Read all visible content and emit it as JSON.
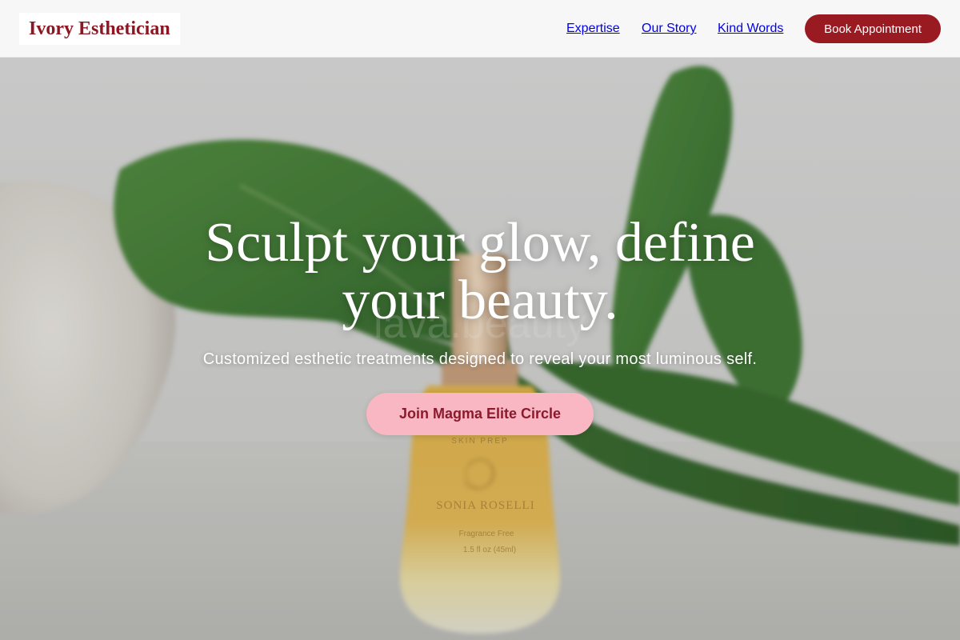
{
  "brand": {
    "name": "Ivory Esthetician"
  },
  "nav": {
    "items": [
      {
        "label": "Expertise"
      },
      {
        "label": "Our Story"
      },
      {
        "label": "Kind Words"
      }
    ],
    "cta_label": "Book Appointment"
  },
  "hero": {
    "title": "Sculpt your glow, define your beauty.",
    "subtitle": "Customized esthetic treatments designed to reveal your most luminous self.",
    "cta_label": "Join Magma Elite Circle",
    "background_text": {
      "watermark": "lava.beauty",
      "label_top": "SKIN PREP",
      "brand_on_bottle": "SONIA ROSELLI",
      "label_line_1": "Fragrance Free",
      "label_line_2": "1.5 fl oz (45ml)"
    }
  },
  "colors": {
    "brand": "#8e1622",
    "button_primary": "#9a1a22",
    "button_cta": "#f9b7c3",
    "button_cta_text": "#8c1a2c",
    "header_bg": "#f7f7f7"
  }
}
